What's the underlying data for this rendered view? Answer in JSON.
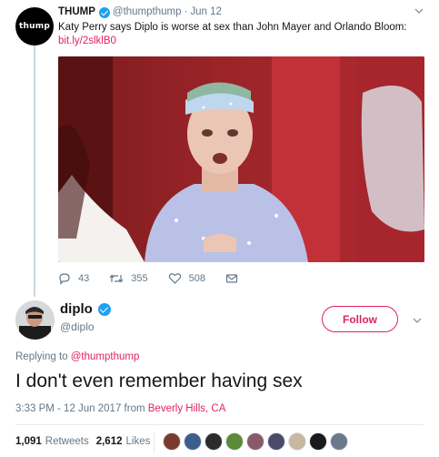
{
  "quoted_tweet": {
    "avatar_text": "thump",
    "name": "THUMP",
    "handle": "@thumpthump",
    "date": "Jun 12",
    "separator": "·",
    "text": "Katy Perry says Diplo is worse at sex than John Mayer and Orlando Bloom:",
    "link": "bit.ly/2slklB0",
    "actions": {
      "replies": "43",
      "retweets": "355",
      "likes": "508"
    }
  },
  "main_tweet": {
    "name": "diplo",
    "handle": "@diplo",
    "follow_label": "Follow",
    "replying_to_prefix": "Replying to",
    "replying_to_mention": "@thumpthump",
    "text": "I don't even remember having sex",
    "timestamp": "3:33 PM - 12 Jun 2017 from",
    "location": "Beverly Hills, CA",
    "retweets_count": "1,091",
    "retweets_label": "Retweets",
    "likes_count": "2,612",
    "likes_label": "Likes"
  },
  "colors": {
    "accent": "#e0245e",
    "verified": "#1da1f2",
    "muted": "#657786"
  },
  "icons": [
    "chevron-down-icon",
    "verified-badge-icon",
    "reply-icon",
    "retweet-icon",
    "like-icon",
    "dm-icon"
  ]
}
